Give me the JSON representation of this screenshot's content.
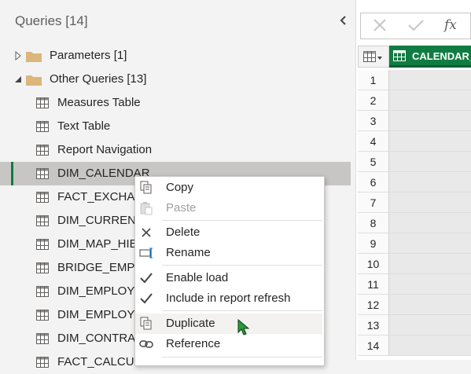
{
  "pane": {
    "title": "Queries [14]"
  },
  "tree": {
    "groups": [
      {
        "label": "Parameters [1]",
        "expanded": false
      },
      {
        "label": "Other Queries [13]",
        "expanded": true
      }
    ],
    "queries": [
      "Measures Table",
      "Text Table",
      "Report Navigation",
      "DIM_CALENDAR",
      "FACT_EXCHAN",
      "DIM_CURRENC",
      "DIM_MAP_HIEI",
      "BRIDGE_EMPLO",
      "DIM_EMPLOYE",
      "DIM_EMPLOYE",
      "DIM_CONTRAC",
      "FACT_CALCUL"
    ],
    "selected_index": 3
  },
  "formula_bar": {
    "cancel_icon": "x-icon",
    "commit_icon": "check-icon",
    "fx_label": "fx"
  },
  "grid": {
    "column_header": "CALENDAR_",
    "row_numbers": [
      "1",
      "2",
      "3",
      "4",
      "5",
      "6",
      "7",
      "8",
      "9",
      "10",
      "11",
      "12",
      "13",
      "14"
    ]
  },
  "context_menu": {
    "copy": "Copy",
    "paste": "Paste",
    "delete": "Delete",
    "rename": "Rename",
    "enable_load": "Enable load",
    "include_refresh": "Include in report refresh",
    "duplicate": "Duplicate",
    "reference": "Reference"
  },
  "colors": {
    "accent": "#107c41",
    "selected_row": "#c8c6c4",
    "pane_bg": "#f3f3f3"
  }
}
